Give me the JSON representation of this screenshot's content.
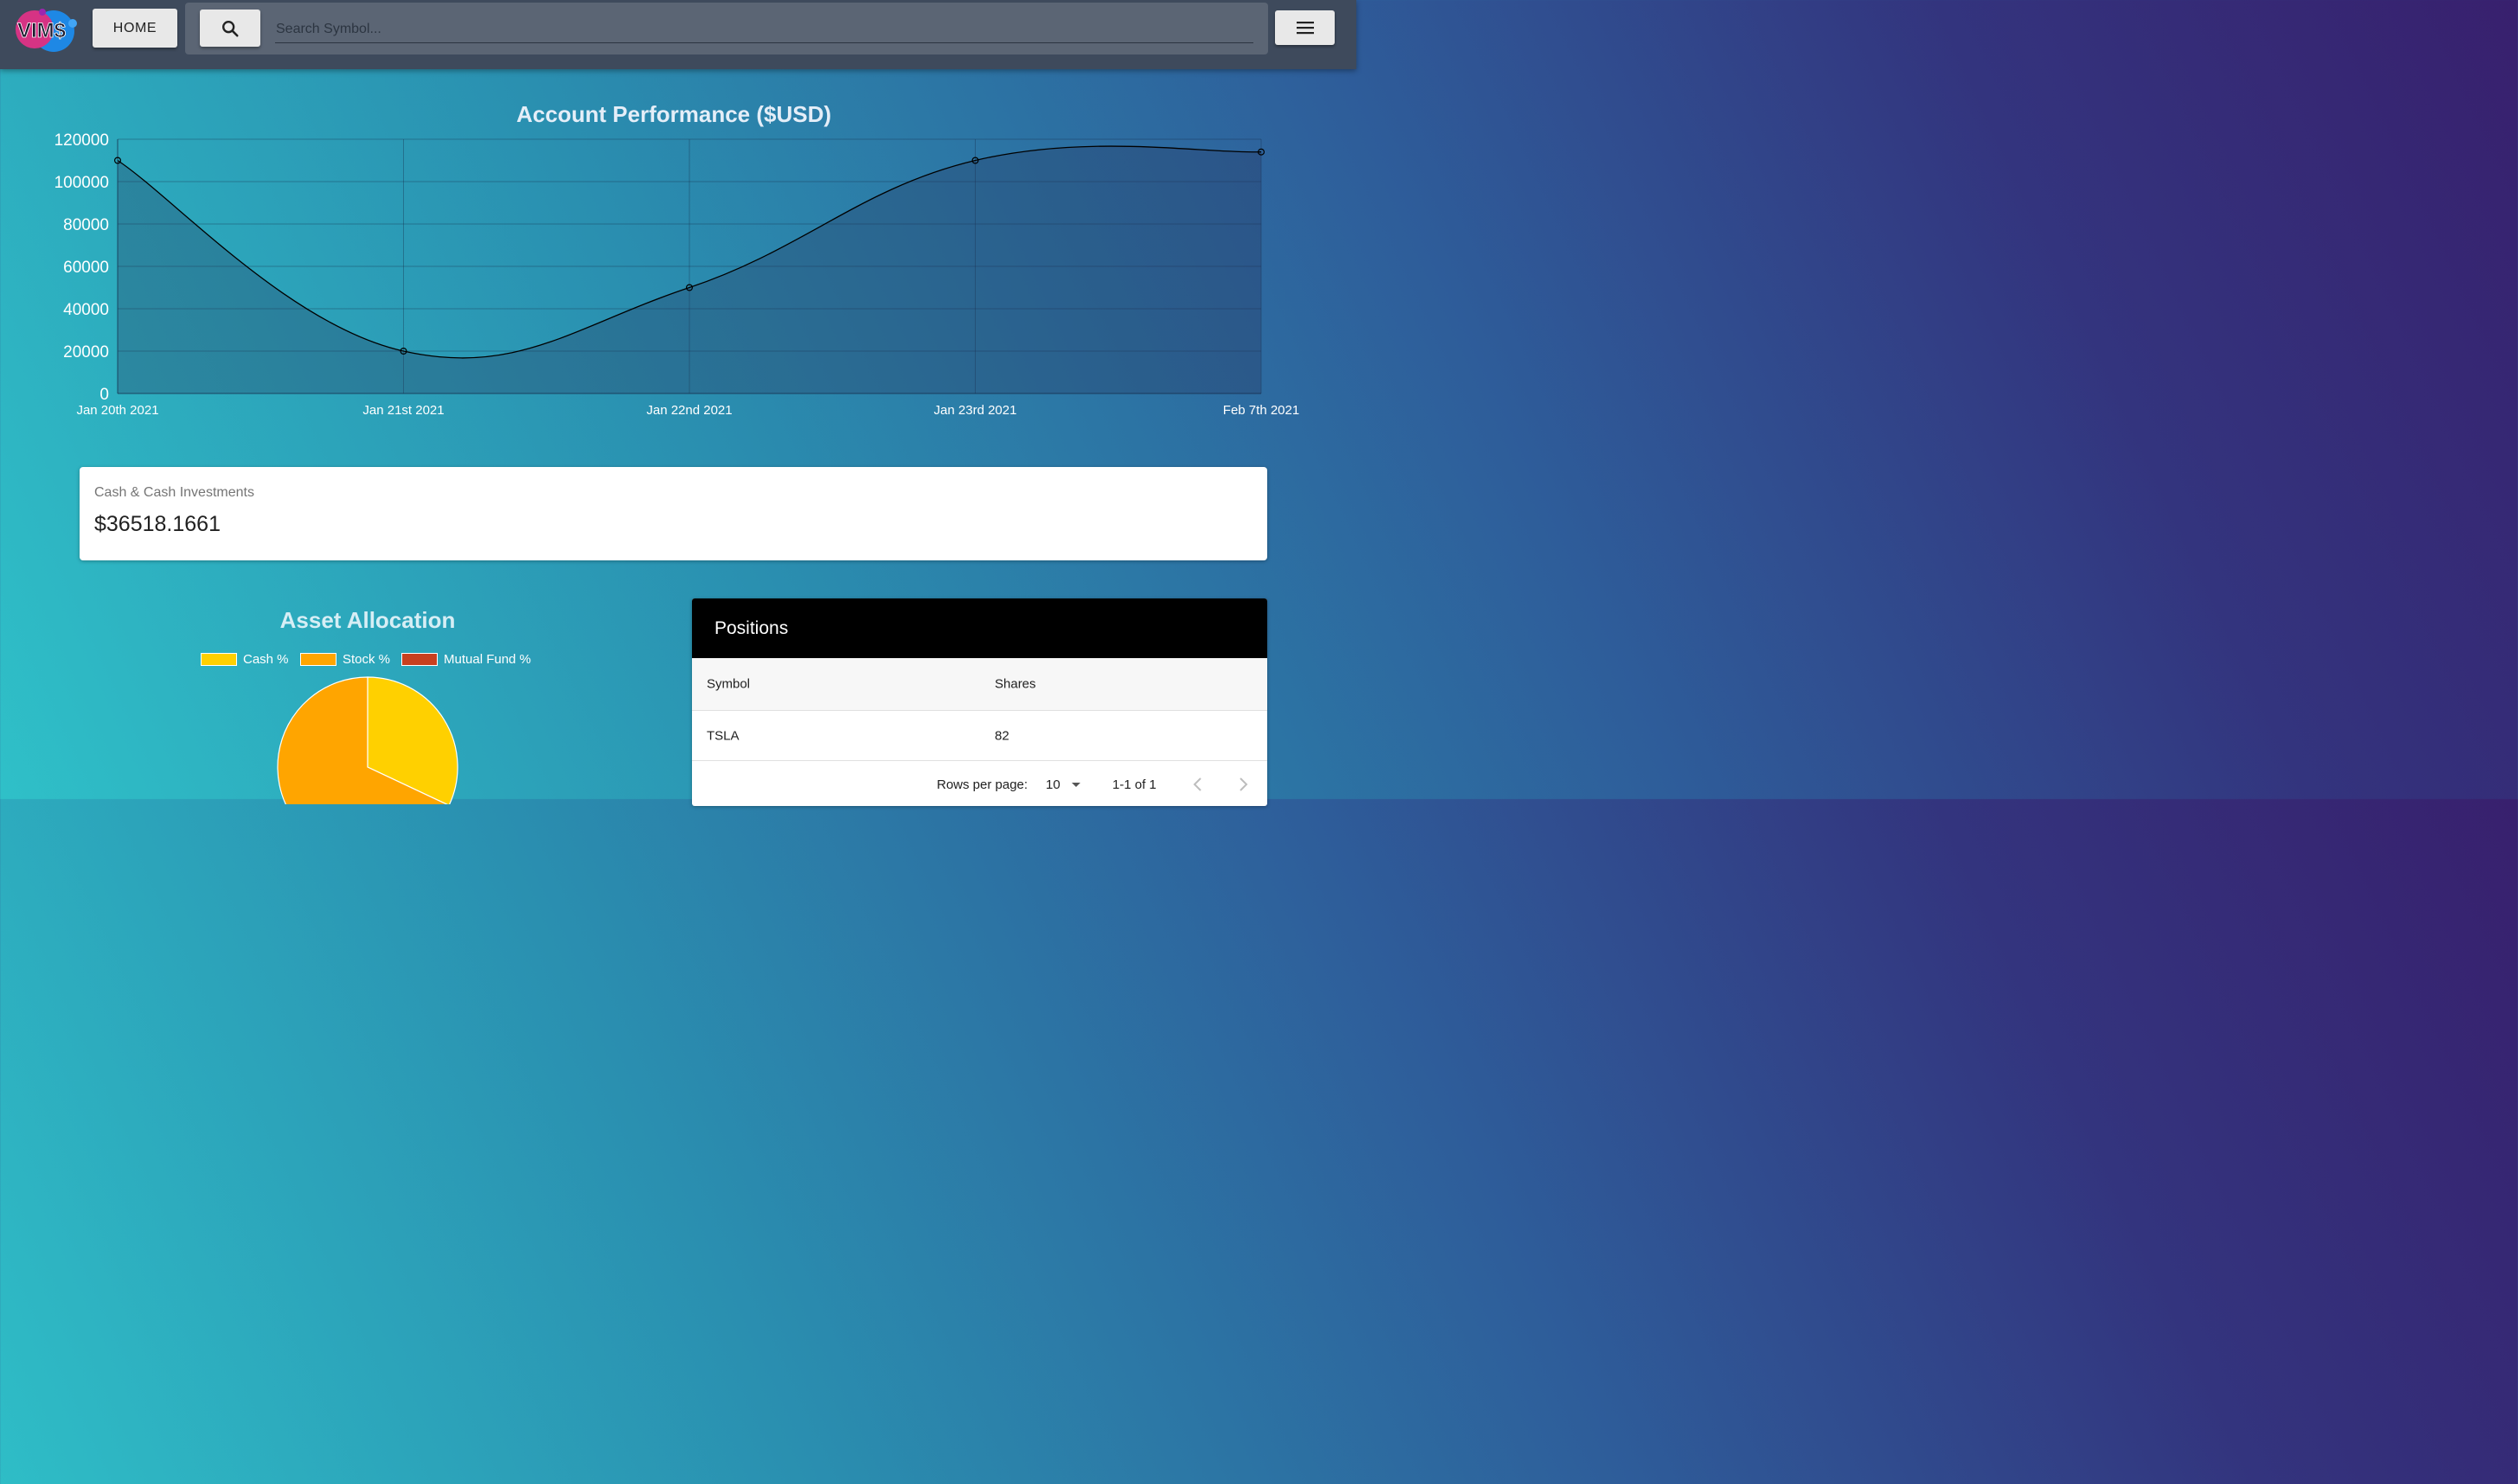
{
  "app": {
    "logo_text": "VIM$",
    "colors": {
      "accent": "#e91e8c",
      "brand_blue": "#2196f3",
      "topbar": "#3e4a5c"
    }
  },
  "header": {
    "home_label": "HOME",
    "search_icon": "search-icon",
    "search_placeholder": "Search Symbol...",
    "search_value": "",
    "menu_icon": "hamburger-menu-icon"
  },
  "performance": {
    "chart_data": {
      "type": "area",
      "title": "Account Performance ($USD)",
      "categories": [
        "Jan 20th 2021",
        "Jan 21st 2021",
        "Jan 22nd 2021",
        "Jan 23rd 2021",
        "Feb 7th 2021"
      ],
      "values": [
        110000,
        20000,
        50000,
        110000,
        114000
      ],
      "yticks": [
        0,
        20000,
        40000,
        60000,
        80000,
        100000,
        120000
      ],
      "ylim": [
        0,
        120000
      ],
      "grid": true,
      "legend": "none",
      "line_color": "#000000",
      "fill_color": "rgba(40,50,90,0.3)"
    }
  },
  "cash": {
    "label": "Cash & Cash Investments",
    "value": "$36518.1661"
  },
  "allocation": {
    "chart_data": {
      "type": "pie",
      "title": "Asset Allocation",
      "categories": [
        "Cash %",
        "Stock %",
        "Mutual Fund %"
      ],
      "values": [
        32,
        68,
        0
      ],
      "colors": [
        "#ffd000",
        "#ffa500",
        "#c8401f"
      ],
      "legend": "top"
    }
  },
  "positions": {
    "title": "Positions",
    "columns": [
      "Symbol",
      "Shares"
    ],
    "rows": [
      {
        "symbol": "TSLA",
        "shares": "82"
      }
    ],
    "pagination": {
      "rows_per_page_label": "Rows per page:",
      "rows_per_page": "10",
      "range": "1-1 of 1"
    }
  }
}
